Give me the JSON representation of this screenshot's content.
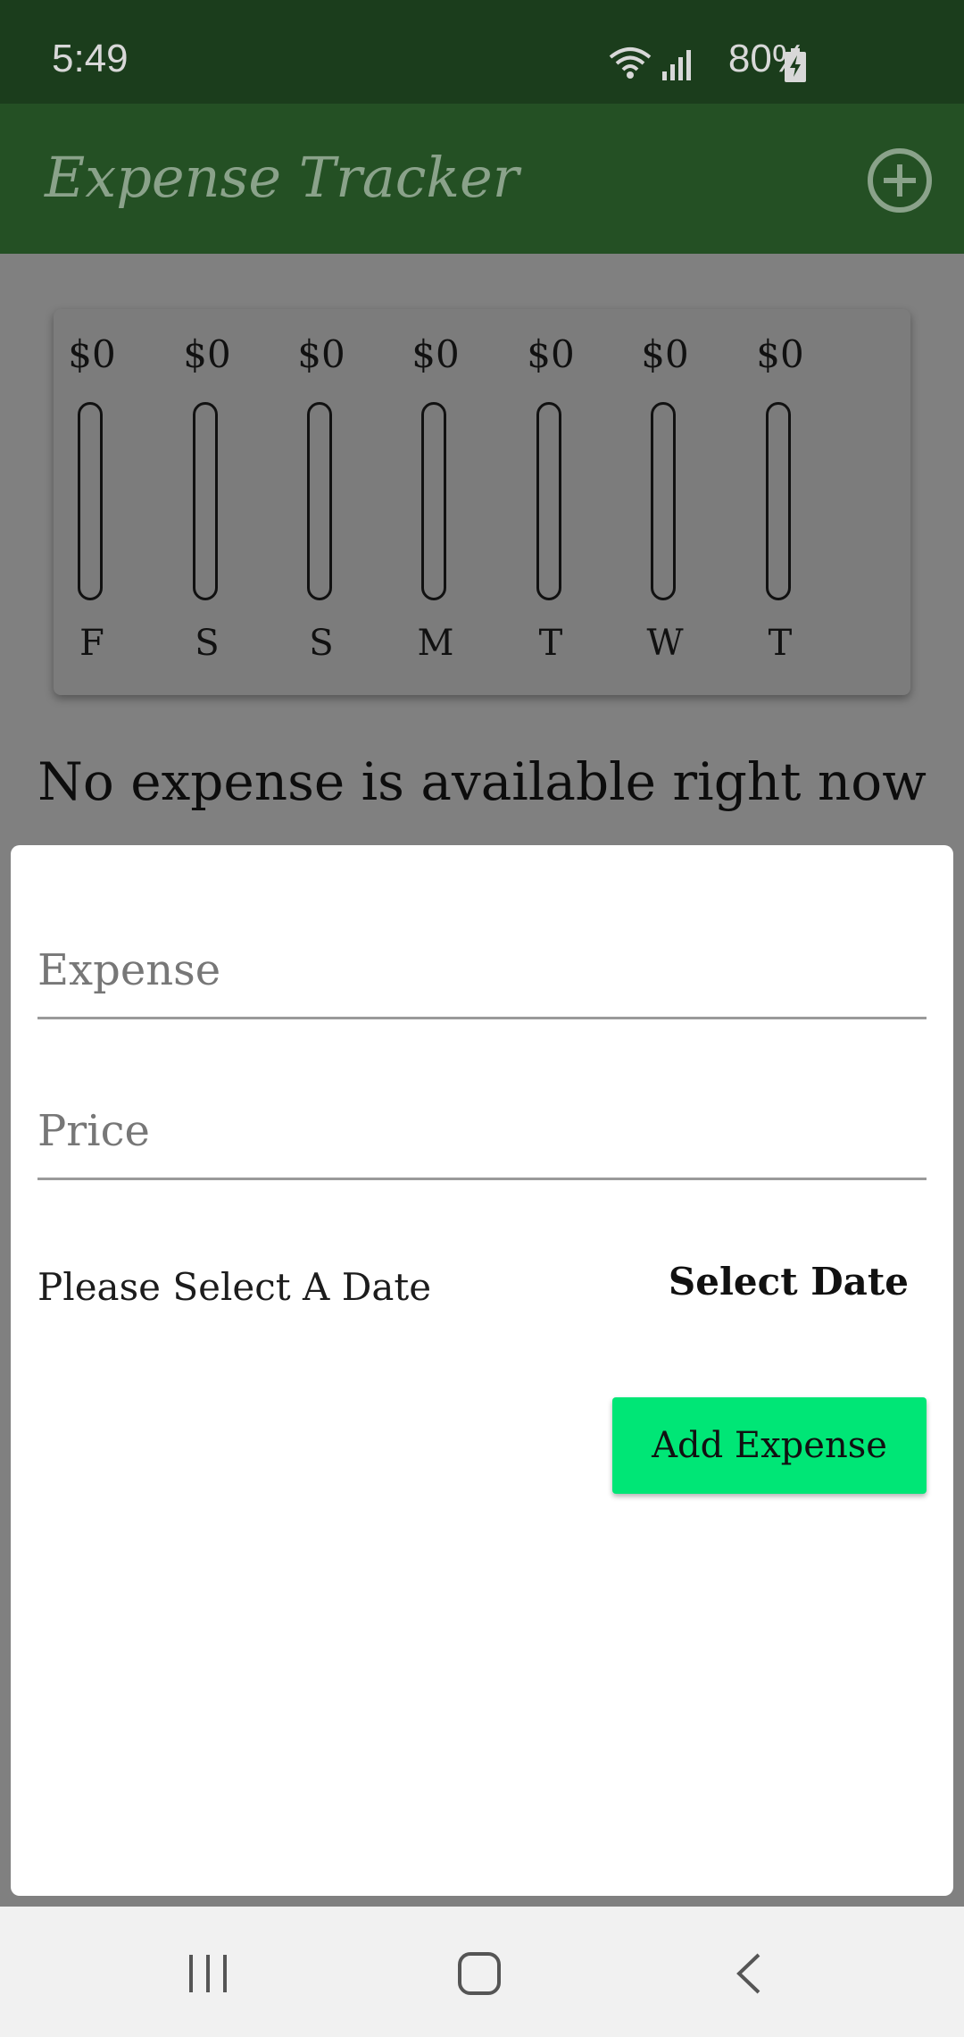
{
  "status_bar": {
    "time": "5:49",
    "battery": "80%"
  },
  "app_bar": {
    "title": "Expense Tracker",
    "add_icon": "plus-circle-icon"
  },
  "chart_data": {
    "type": "bar",
    "categories": [
      "F",
      "S",
      "S",
      "M",
      "T",
      "W",
      "T"
    ],
    "values": [
      0,
      0,
      0,
      0,
      0,
      0,
      0
    ],
    "value_labels": [
      "$0",
      "$0",
      "$0",
      "$0",
      "$0",
      "$0",
      "$0"
    ]
  },
  "empty_message": "No expense is available right now",
  "sheet": {
    "expense_placeholder": "Expense",
    "price_placeholder": "Price",
    "date_label": "Please Select A Date",
    "select_date_label": "Select Date",
    "add_button_label": "Add Expense"
  },
  "colors": {
    "primary": "#245024",
    "status_bar": "#1b3d1c",
    "accent_button": "#00e676",
    "scrim": "#808080"
  },
  "nav_bar": {
    "icons": [
      "recents-icon",
      "home-icon",
      "back-icon"
    ]
  }
}
